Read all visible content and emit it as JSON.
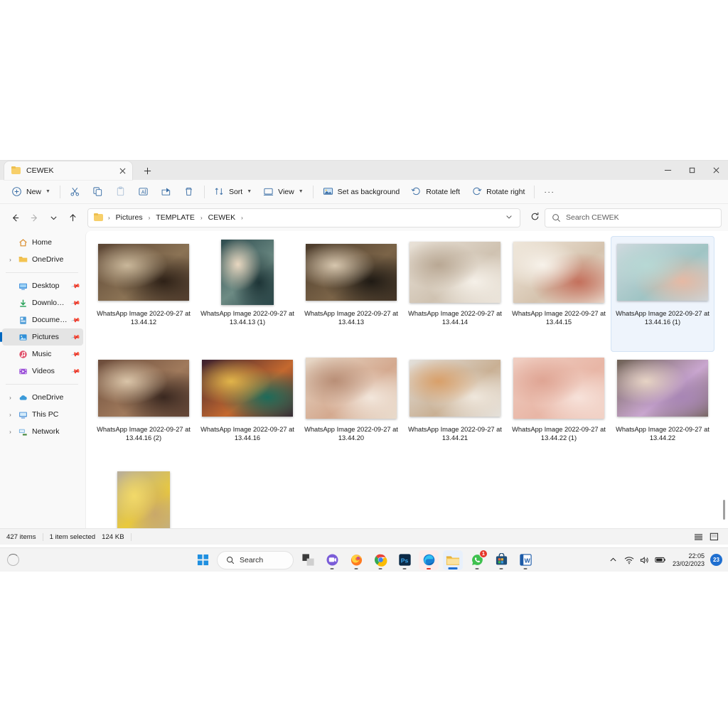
{
  "window": {
    "tab_title": "CEWEK",
    "tab_close_icon": "close-icon",
    "new_tab_icon": "plus-icon",
    "minimize_icon": "minimize-icon",
    "maximize_icon": "maximize-icon",
    "close_icon": "close-icon"
  },
  "toolbar": {
    "new_label": "New",
    "cut_icon": "scissors-icon",
    "copy_icon": "copy-icon",
    "paste_icon": "paste-icon",
    "rename_icon": "rename-icon",
    "share_icon": "share-icon",
    "delete_icon": "trash-icon",
    "sort_label": "Sort",
    "view_label": "View",
    "set_as_background_label": "Set as background",
    "rotate_left_label": "Rotate left",
    "rotate_right_label": "Rotate right",
    "more_label": "···"
  },
  "nav": {
    "back_icon": "arrow-left-icon",
    "forward_icon": "arrow-right-icon",
    "recent_icon": "chevron-down-icon",
    "up_icon": "arrow-up-icon",
    "refresh_icon": "refresh-icon",
    "breadcrumbs": [
      "Pictures",
      "TEMPLATE",
      "CEWEK"
    ],
    "separator": "›"
  },
  "search": {
    "placeholder": "Search CEWEK",
    "icon": "search-icon"
  },
  "sidebar": {
    "groups": [
      {
        "items": [
          {
            "label": "Home",
            "icon": "home-icon",
            "expandable": false,
            "pinned": false,
            "selected": false
          },
          {
            "label": "OneDrive",
            "icon": "folder-icon",
            "expandable": true,
            "pinned": false,
            "selected": false
          }
        ]
      },
      {
        "items": [
          {
            "label": "Desktop",
            "icon": "desktop-icon",
            "expandable": false,
            "pinned": true,
            "selected": false
          },
          {
            "label": "Downloads",
            "icon": "download-icon",
            "expandable": false,
            "pinned": true,
            "selected": false
          },
          {
            "label": "Documents",
            "icon": "document-icon",
            "expandable": false,
            "pinned": true,
            "selected": false
          },
          {
            "label": "Pictures",
            "icon": "pictures-icon",
            "expandable": false,
            "pinned": true,
            "selected": true
          },
          {
            "label": "Music",
            "icon": "music-icon",
            "expandable": false,
            "pinned": true,
            "selected": false
          },
          {
            "label": "Videos",
            "icon": "video-icon",
            "expandable": false,
            "pinned": true,
            "selected": false
          }
        ]
      },
      {
        "items": [
          {
            "label": "OneDrive",
            "icon": "cloud-icon",
            "expandable": true,
            "pinned": false,
            "selected": false
          },
          {
            "label": "This PC",
            "icon": "pc-icon",
            "expandable": true,
            "pinned": false,
            "selected": false
          },
          {
            "label": "Network",
            "icon": "network-icon",
            "expandable": true,
            "pinned": false,
            "selected": false
          }
        ]
      }
    ]
  },
  "files": [
    {
      "name": "WhatsApp Image 2022-09-27 at 13.44.12",
      "selected": false,
      "palette": [
        "#5a4433",
        "#8b7355",
        "#2e2117",
        "#c9b79a"
      ]
    },
    {
      "name": "WhatsApp Image 2022-09-27 at 13.44.13 (1)",
      "selected": false,
      "palette": [
        "#2d4b4e",
        "#6d8b84",
        "#1d3436",
        "#e8d7c0"
      ]
    },
    {
      "name": "WhatsApp Image 2022-09-27 at 13.44.13",
      "selected": false,
      "palette": [
        "#4a3a2a",
        "#7b6448",
        "#1f1a14",
        "#d6c6ae"
      ]
    },
    {
      "name": "WhatsApp Image 2022-09-27 at 13.44.14",
      "selected": false,
      "palette": [
        "#e9e2d8",
        "#cfc2b1",
        "#f5f0e8",
        "#b9a894"
      ]
    },
    {
      "name": "WhatsApp Image 2022-09-27 at 13.44.15",
      "selected": false,
      "palette": [
        "#efe7db",
        "#d5c3ae",
        "#c4705c",
        "#f7f2ea"
      ]
    },
    {
      "name": "WhatsApp Image 2022-09-27 at 13.44.16 (1)",
      "selected": true,
      "palette": [
        "#cfd9de",
        "#9fc4c4",
        "#e6b9a4",
        "#b7d8d4"
      ]
    },
    {
      "name": "WhatsApp Image 2022-09-27 at 13.44.16 (2)",
      "selected": false,
      "palette": [
        "#6b4b3a",
        "#a07a5c",
        "#3a2820",
        "#d9c4a8"
      ]
    },
    {
      "name": "WhatsApp Image 2022-09-27 at 13.44.16",
      "selected": false,
      "palette": [
        "#3a1f2e",
        "#c4692f",
        "#1d6b5a",
        "#e0b44a"
      ]
    },
    {
      "name": "WhatsApp Image 2022-09-27 at 13.44.20",
      "selected": false,
      "palette": [
        "#e7d9c9",
        "#d4a98f",
        "#f2e6db",
        "#b98f77"
      ]
    },
    {
      "name": "WhatsApp Image 2022-09-27 at 13.44.21",
      "selected": false,
      "palette": [
        "#e3e0db",
        "#c9b094",
        "#efe7dc",
        "#d9a06a"
      ]
    },
    {
      "name": "WhatsApp Image 2022-09-27 at 13.44.22 (1)",
      "selected": false,
      "palette": [
        "#f0cfc3",
        "#e8b6a6",
        "#f7e2da",
        "#dfa594"
      ]
    },
    {
      "name": "WhatsApp Image 2022-09-27 at 13.44.22",
      "selected": false,
      "palette": [
        "#6e6154",
        "#c9a6cf",
        "#a886b5",
        "#e6d3c4"
      ]
    },
    {
      "name": "",
      "selected": false,
      "palette": [
        "#b8ae9c",
        "#e9c93c",
        "#c9a86a",
        "#f2d969"
      ]
    }
  ],
  "statusbar": {
    "item_count": "427 items",
    "selection": "1 item selected",
    "size": "124 KB",
    "details_view_icon": "details-view-icon",
    "large_icons_view_icon": "large-icons-view-icon"
  },
  "taskbar": {
    "start_icon": "windows-start-icon",
    "search_label": "Search",
    "search_icon": "search-icon",
    "items": [
      {
        "name": "task-view",
        "icon": "task-view-icon"
      },
      {
        "name": "teams",
        "icon": "teams-icon"
      },
      {
        "name": "firefox",
        "icon": "firefox-icon"
      },
      {
        "name": "chrome",
        "icon": "chrome-icon"
      },
      {
        "name": "photoshop",
        "icon": "photoshop-icon",
        "label": "Ps"
      },
      {
        "name": "edge",
        "icon": "edge-icon"
      },
      {
        "name": "file-explorer",
        "icon": "file-explorer-icon"
      },
      {
        "name": "whatsapp",
        "icon": "whatsapp-icon",
        "badge": "1"
      },
      {
        "name": "microsoft-store",
        "icon": "store-icon"
      },
      {
        "name": "word",
        "icon": "word-icon",
        "label": "W"
      }
    ],
    "tray": {
      "chevron_icon": "chevron-up-icon",
      "wifi_icon": "wifi-icon",
      "volume_icon": "volume-icon",
      "battery_icon": "battery-icon",
      "time": "22:05",
      "date": "23/02/2023",
      "notification_count": "23"
    }
  }
}
